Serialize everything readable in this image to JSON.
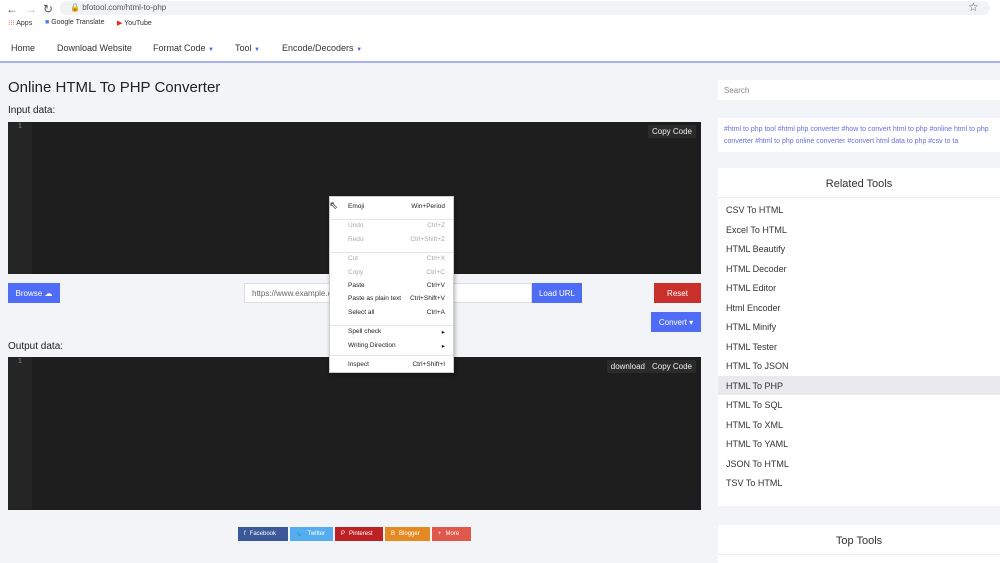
{
  "browser": {
    "url": "bfotool.com/html-to-php",
    "bookmarks": [
      "Apps",
      "Google Translate",
      "YouTube"
    ]
  },
  "nav": {
    "items": [
      "Home",
      "Download Website",
      "Format Code",
      "Tool",
      "Encode/Decoders"
    ]
  },
  "page": {
    "title": "Online HTML To PHP Converter",
    "input_label": "Input data:",
    "output_label": "Output data:",
    "line_number": "1",
    "copy_code": "Copy Code",
    "download": "download",
    "browse": "Browse",
    "url_placeholder": "https://www.example.com",
    "load_url": "Load URL",
    "reset": "Reset",
    "convert": "Convert"
  },
  "context_menu": [
    {
      "label": "Emoji",
      "shortcut": "Win+Period",
      "disabled": false
    },
    {
      "label": "Undo",
      "shortcut": "Ctrl+Z",
      "disabled": true
    },
    {
      "label": "Redo",
      "shortcut": "Ctrl+Shift+Z",
      "disabled": true
    },
    {
      "label": "Cut",
      "shortcut": "Ctrl+X",
      "disabled": true
    },
    {
      "label": "Copy",
      "shortcut": "Ctrl+C",
      "disabled": true
    },
    {
      "label": "Paste",
      "shortcut": "Ctrl+V",
      "disabled": false
    },
    {
      "label": "Paste as plain text",
      "shortcut": "Ctrl+Shift+V",
      "disabled": false
    },
    {
      "label": "Select all",
      "shortcut": "Ctrl+A",
      "disabled": false
    },
    {
      "label": "Spell check",
      "shortcut": "▸",
      "disabled": false
    },
    {
      "label": "Writing Direction",
      "shortcut": "▸",
      "disabled": false
    },
    {
      "label": "Inspect",
      "shortcut": "Ctrl+Shift+I",
      "disabled": false
    }
  ],
  "share": [
    {
      "label": "Facebook",
      "color": "#3b5998"
    },
    {
      "label": "Twitter",
      "color": "#55acee"
    },
    {
      "label": "Pinterest",
      "color": "#bd2126"
    },
    {
      "label": "Blogger",
      "color": "#e58a22"
    },
    {
      "label": "More",
      "color": "#e0584a"
    }
  ],
  "sidebar": {
    "search_placeholder": "Search",
    "tags": "#html to php tool  #html php converter  #how to convert html to php  #online html to php converter  #html to php online converter  #convert html data to php  #csv to ta",
    "related_title": "Related Tools",
    "related": [
      "CSV To HTML",
      "Excel To HTML",
      "HTML Beautify",
      "HTML Decoder",
      "HTML Editor",
      "Html Encoder",
      "HTML Minify",
      "HTML Tester",
      "HTML To JSON",
      "HTML To PHP",
      "HTML To SQL",
      "HTML To XML",
      "HTML To YAML",
      "JSON To HTML",
      "TSV To HTML"
    ],
    "selected": "HTML To PHP",
    "top_title": "Top Tools"
  }
}
